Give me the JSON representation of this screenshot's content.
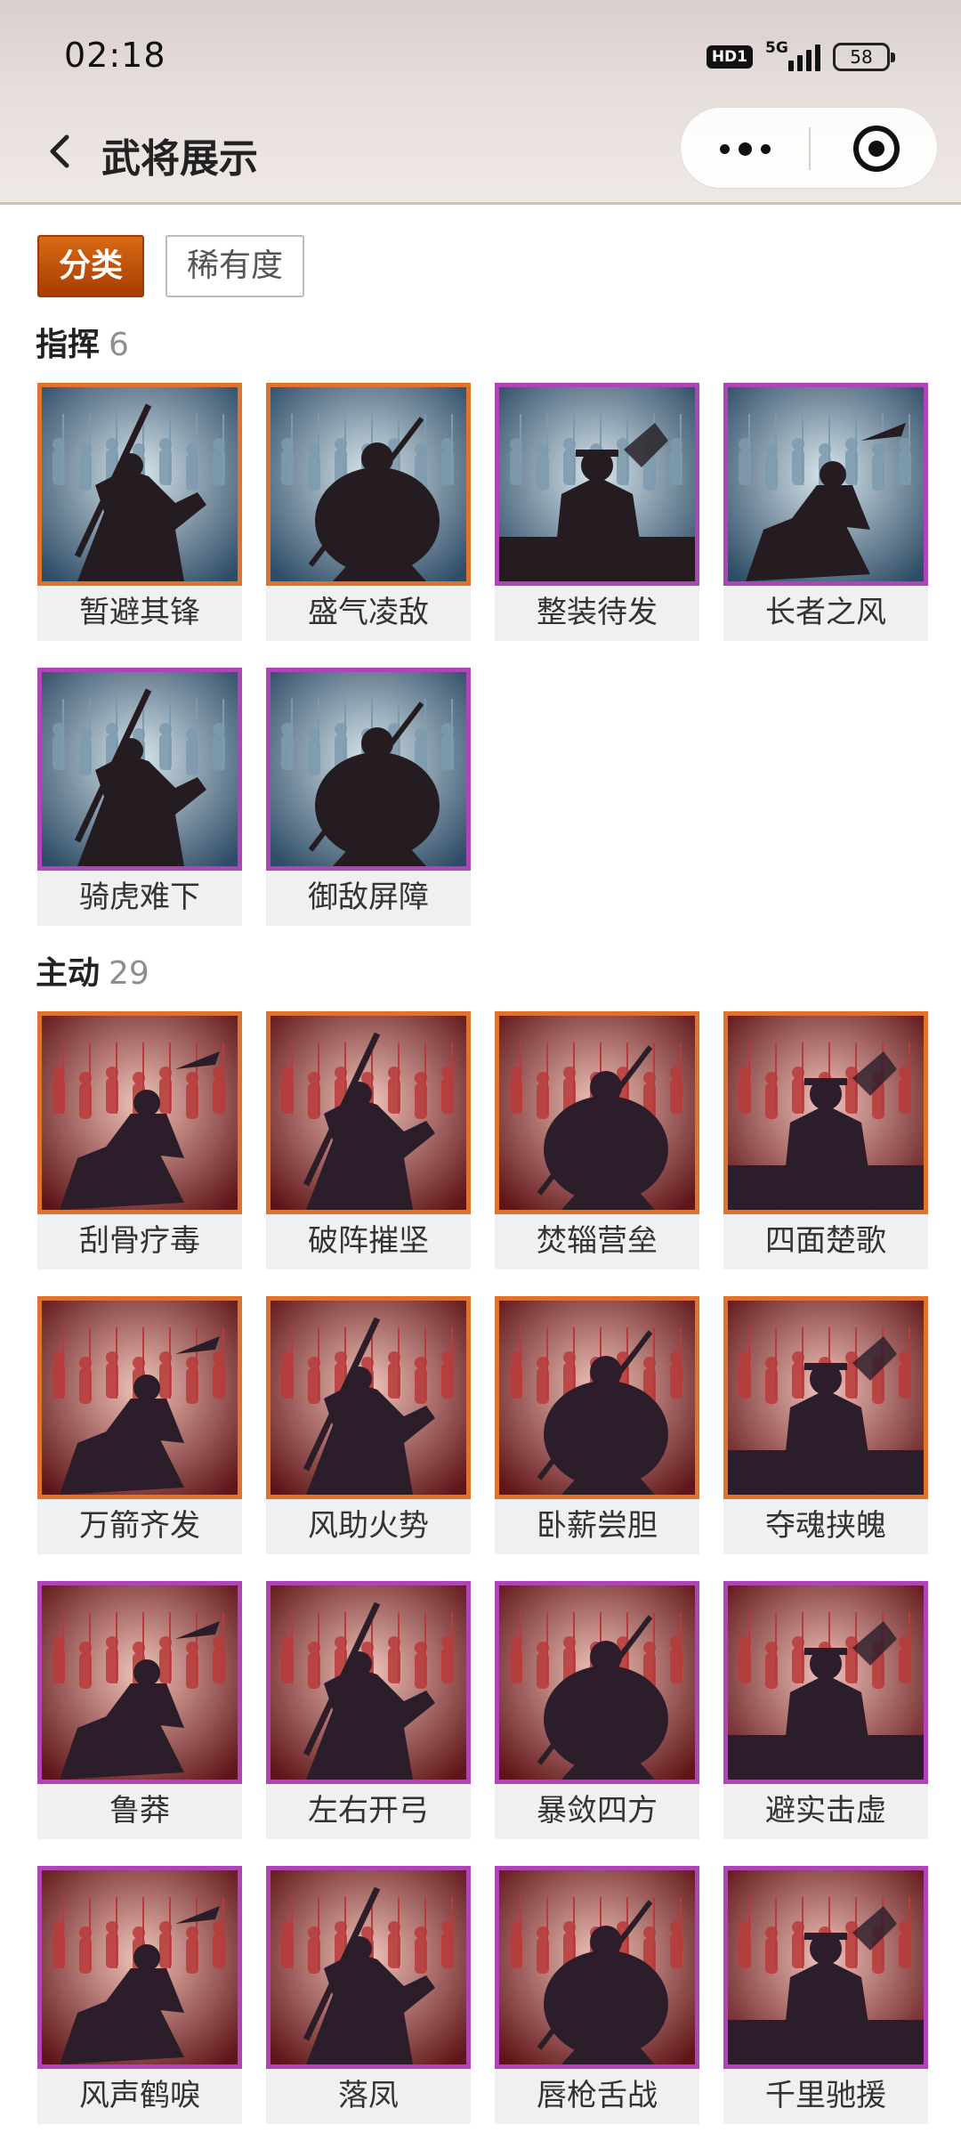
{
  "status_bar": {
    "time": "02:18",
    "hd_badge": "HD1",
    "network": "5G",
    "battery": "58"
  },
  "nav": {
    "title": "武将展示",
    "back_icon": "chevron-left-icon",
    "more_icon": "more-dots-icon",
    "close_icon": "target-circle-icon"
  },
  "filters": [
    {
      "label": "分类",
      "active": true
    },
    {
      "label": "稀有度",
      "active": false
    }
  ],
  "colors": {
    "orange_rarity": "#e07230",
    "purple_rarity": "#b043b7",
    "active_tab": "#c0530b"
  },
  "sections": [
    {
      "title": "指挥",
      "count": "6",
      "items": [
        {
          "name": "暂避其锋",
          "rarity": "orange",
          "theme": "blue"
        },
        {
          "name": "盛气凌敌",
          "rarity": "orange",
          "theme": "blue"
        },
        {
          "name": "整装待发",
          "rarity": "purple",
          "theme": "blue"
        },
        {
          "name": "长者之风",
          "rarity": "purple",
          "theme": "blue"
        },
        {
          "name": "骑虎难下",
          "rarity": "purple",
          "theme": "blue"
        },
        {
          "name": "御敌屏障",
          "rarity": "purple",
          "theme": "blue"
        }
      ]
    },
    {
      "title": "主动",
      "count": "29",
      "items": [
        {
          "name": "刮骨疗毒",
          "rarity": "orange",
          "theme": "red"
        },
        {
          "name": "破阵摧坚",
          "rarity": "orange",
          "theme": "red"
        },
        {
          "name": "焚辎营垒",
          "rarity": "orange",
          "theme": "red"
        },
        {
          "name": "四面楚歌",
          "rarity": "orange",
          "theme": "red"
        },
        {
          "name": "万箭齐发",
          "rarity": "orange",
          "theme": "red"
        },
        {
          "name": "风助火势",
          "rarity": "orange",
          "theme": "red"
        },
        {
          "name": "卧薪尝胆",
          "rarity": "orange",
          "theme": "red"
        },
        {
          "name": "夺魂挟魄",
          "rarity": "orange",
          "theme": "red"
        },
        {
          "name": "鲁莽",
          "rarity": "purple",
          "theme": "red"
        },
        {
          "name": "左右开弓",
          "rarity": "purple",
          "theme": "red"
        },
        {
          "name": "暴敛四方",
          "rarity": "purple",
          "theme": "red"
        },
        {
          "name": "避实击虚",
          "rarity": "purple",
          "theme": "red"
        },
        {
          "name": "风声鹤唳",
          "rarity": "purple",
          "theme": "red"
        },
        {
          "name": "落凤",
          "rarity": "purple",
          "theme": "red"
        },
        {
          "name": "唇枪舌战",
          "rarity": "purple",
          "theme": "red"
        },
        {
          "name": "千里驰援",
          "rarity": "purple",
          "theme": "red"
        }
      ]
    }
  ]
}
